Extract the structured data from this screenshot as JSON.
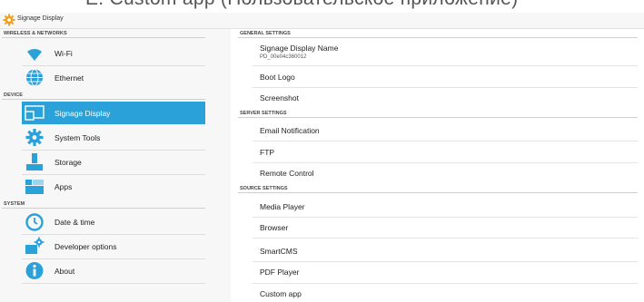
{
  "top_caption": "E.    Custom app (Пользовательское приложение)",
  "titlebar": {
    "title": "Signage Display"
  },
  "sidebar": {
    "sections": [
      {
        "header": "WIRELESS & NETWORKS",
        "items": [
          {
            "label": "Wi-Fi",
            "icon": "wifi-icon"
          },
          {
            "label": "Ethernet",
            "icon": "ethernet-icon"
          }
        ]
      },
      {
        "header": "DEVICE",
        "items": [
          {
            "label": "Signage Display",
            "icon": "display-icon",
            "active": true
          },
          {
            "label": "System Tools",
            "icon": "gear-icon"
          },
          {
            "label": "Storage",
            "icon": "storage-icon"
          },
          {
            "label": "Apps",
            "icon": "apps-icon"
          }
        ]
      },
      {
        "header": "SYSTEM",
        "items": [
          {
            "label": "Date & time",
            "icon": "clock-icon"
          },
          {
            "label": "Developer options",
            "icon": "developer-icon"
          },
          {
            "label": "About",
            "icon": "info-icon"
          }
        ]
      }
    ]
  },
  "main": {
    "general": {
      "header": "GENERAL SETTINGS",
      "display_name": {
        "title": "Signage Display Name",
        "value": "PD_00e04c360012"
      },
      "boot_logo": "Boot Logo",
      "screenshot": "Screenshot"
    },
    "server": {
      "header": "SERVER SETTINGS",
      "email": "Email Notification",
      "ftp": "FTP",
      "remote": "Remote Control"
    },
    "source": {
      "header": "SOURCE SETTINGS",
      "media_player": "Media Player",
      "browser": "Browser",
      "smartcms": "SmartCMS",
      "pdf_player": "PDF Player",
      "custom_app": "Custom app"
    }
  },
  "colors": {
    "accent": "#2aa1d8",
    "icon": "#2aa1d8"
  }
}
